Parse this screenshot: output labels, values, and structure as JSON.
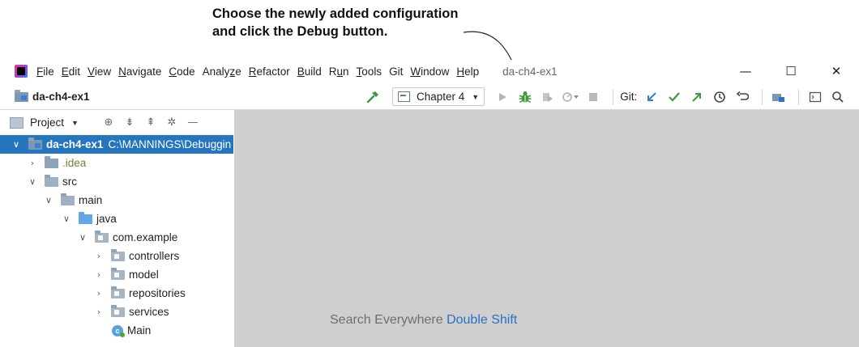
{
  "callout": {
    "line1": "Choose the newly added configuration",
    "line2": "and click the Debug button."
  },
  "menubar": {
    "items": [
      {
        "mnemonic": "F",
        "rest": "ile"
      },
      {
        "mnemonic": "E",
        "rest": "dit"
      },
      {
        "mnemonic": "V",
        "rest": "iew"
      },
      {
        "mnemonic": "N",
        "rest": "avigate"
      },
      {
        "mnemonic": "C",
        "rest": "ode"
      },
      {
        "pre": "Analy",
        "mnemonic": "z",
        "rest": "e"
      },
      {
        "mnemonic": "R",
        "rest": "efactor"
      },
      {
        "mnemonic": "B",
        "rest": "uild"
      },
      {
        "pre": "R",
        "mnemonic": "u",
        "rest": "n"
      },
      {
        "mnemonic": "T",
        "rest": "ools"
      },
      {
        "pre": "Git",
        "mnemonic": "",
        "rest": ""
      },
      {
        "mnemonic": "W",
        "rest": "indow"
      },
      {
        "mnemonic": "H",
        "rest": "elp"
      }
    ],
    "project_title": "da-ch4-ex1",
    "window_controls": {
      "minimize": "—",
      "maximize": "☐",
      "close": "✕"
    }
  },
  "navbar": {
    "project": "da-ch4-ex1",
    "run_config": "Chapter 4",
    "git_label": "Git:"
  },
  "project_pane": {
    "title": "Project",
    "tree": [
      {
        "label": "da-ch4-ex1",
        "path": "C:\\MANNINGS\\Debuggin",
        "arrow": "open"
      },
      {
        "label": ".idea",
        "arrow": "closed"
      },
      {
        "label": "src",
        "arrow": "open"
      },
      {
        "label": "main",
        "arrow": "open"
      },
      {
        "label": "java",
        "arrow": "open"
      },
      {
        "label": "com.example",
        "arrow": "open"
      },
      {
        "label": "controllers",
        "arrow": "closed"
      },
      {
        "label": "model",
        "arrow": "closed"
      },
      {
        "label": "repositories",
        "arrow": "closed"
      },
      {
        "label": "services",
        "arrow": "closed"
      },
      {
        "label": "Main",
        "arrow": "none"
      }
    ]
  },
  "editor": {
    "hint_text": "Search Everywhere",
    "hint_shortcut": "Double Shift"
  },
  "colors": {
    "selection": "#2675bf",
    "debug_green": "#3e9a3e",
    "editor_bg": "#cfcfcf",
    "accent_blue": "#2871c7"
  }
}
